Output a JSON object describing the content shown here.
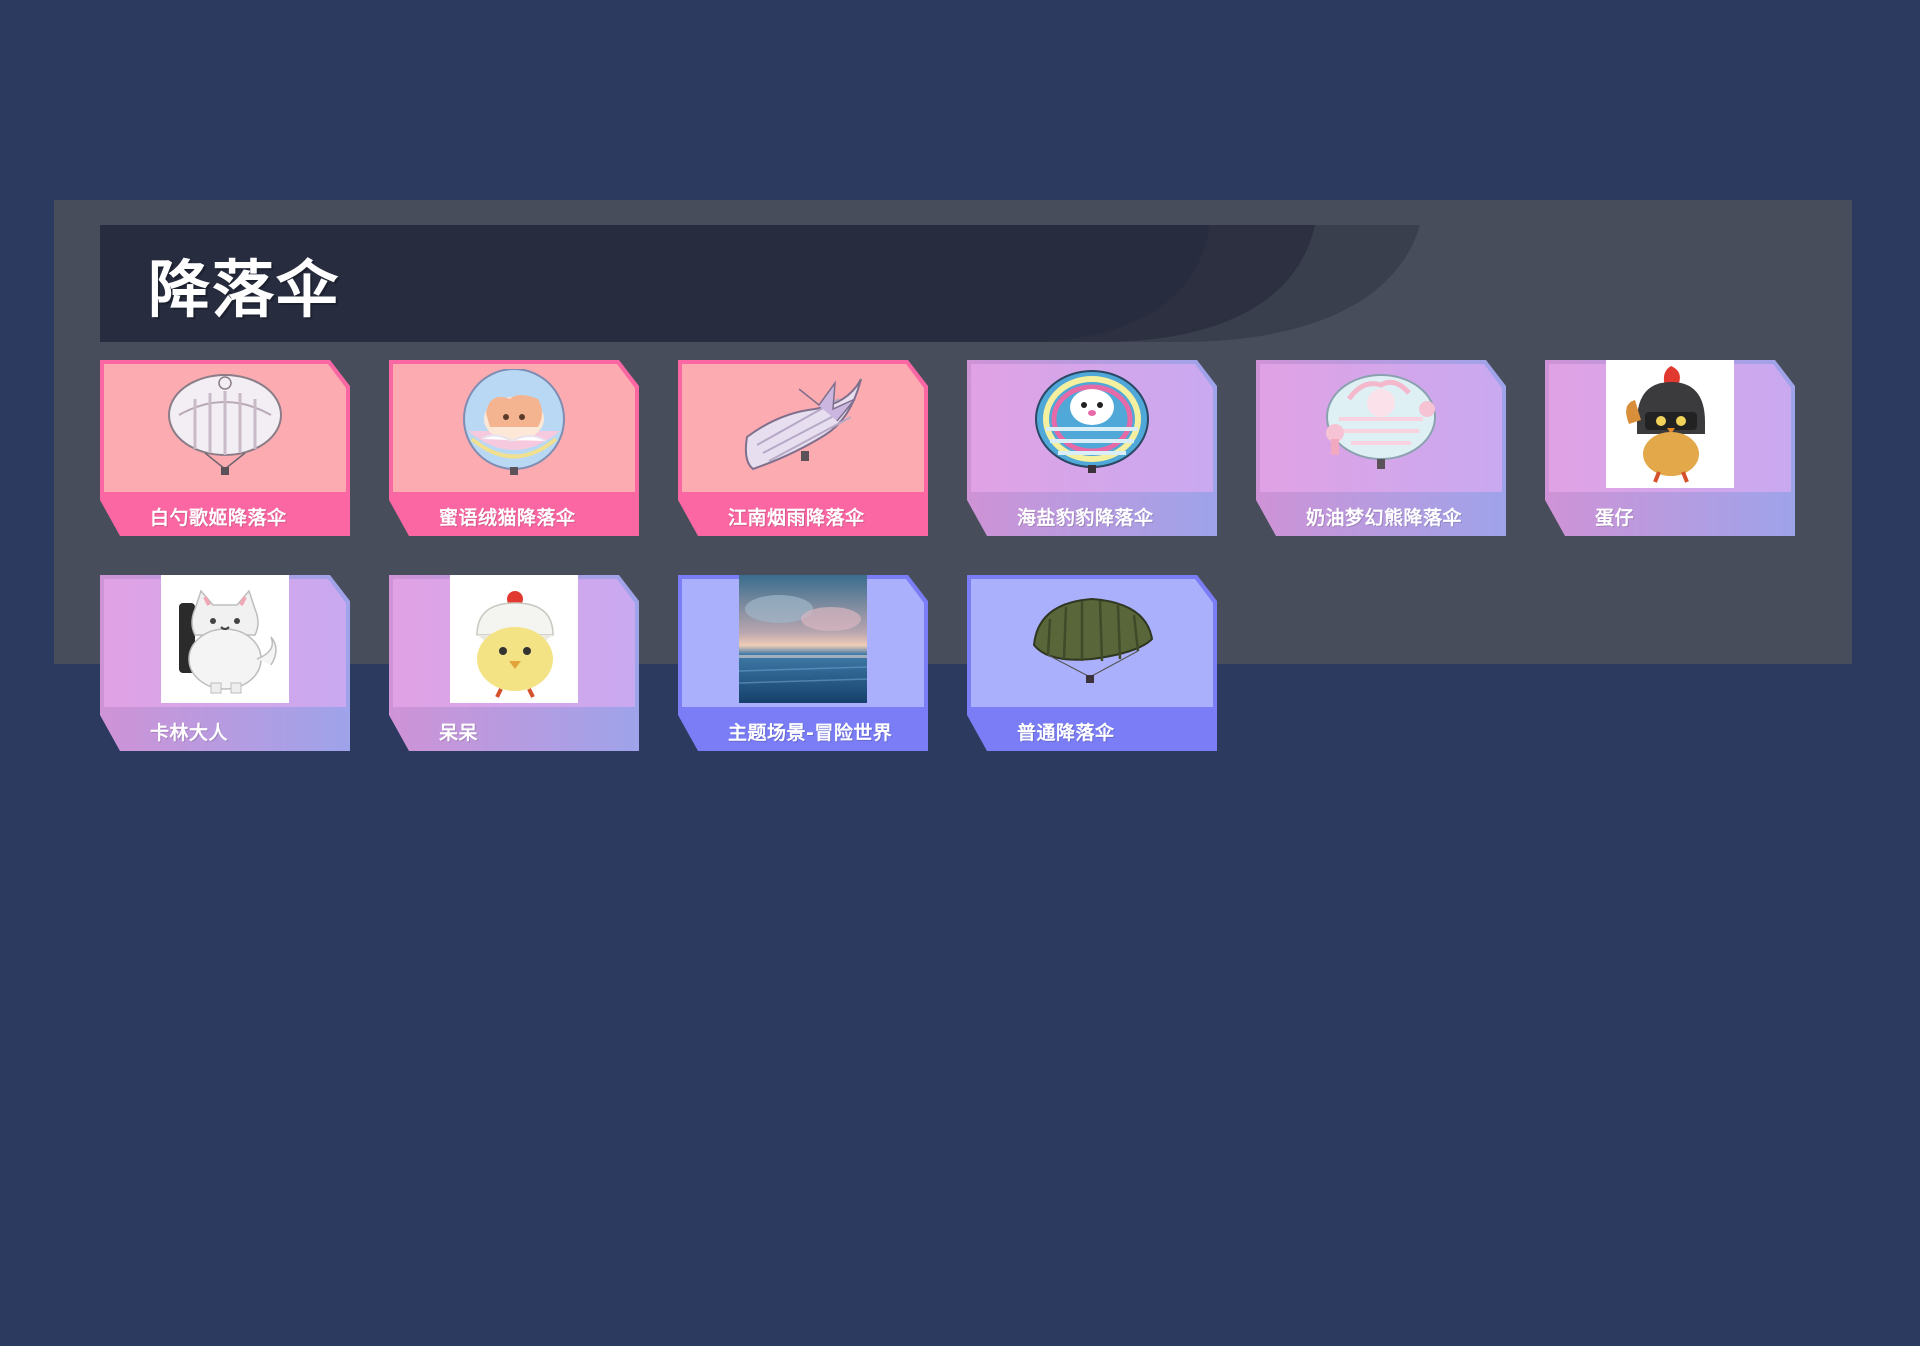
{
  "section": {
    "title": "降落伞"
  },
  "colors": {
    "page_bg": "#2d3a5f",
    "panel_bg": "#474d5a",
    "header_bg": "#272d40",
    "pink_card": "#fcabb1",
    "pink_strip": "#fb67a3",
    "purple_card": "#d9a6ee",
    "purple_strip": "#b3a3ea",
    "blue_card": "#aab0fb",
    "blue_strip": "#7a7df5"
  },
  "items": [
    {
      "name": "白勺歌姬降落伞",
      "tier": "pink",
      "icon": "white-parachute-icon"
    },
    {
      "name": "蜜语绒猫降落伞",
      "tier": "pink",
      "icon": "cat-parachute-icon"
    },
    {
      "name": "江南烟雨降落伞",
      "tier": "pink",
      "icon": "glider-parachute-icon"
    },
    {
      "name": "海盐豹豹降落伞",
      "tier": "purple",
      "icon": "seal-parachute-icon"
    },
    {
      "name": "奶油梦幻熊降落伞",
      "tier": "purple",
      "icon": "bear-parachute-icon"
    },
    {
      "name": "蛋仔",
      "tier": "purple",
      "icon": "eggy-helmet-icon"
    },
    {
      "name": "卡林大人",
      "tier": "purple",
      "icon": "white-cat-icon"
    },
    {
      "name": "呆呆",
      "tier": "purple",
      "icon": "yellow-chick-icon"
    },
    {
      "name": "主题场景-冒险世界",
      "tier": "blue",
      "icon": "sea-scene-icon"
    },
    {
      "name": "普通降落伞",
      "tier": "blue",
      "icon": "green-parachute-icon"
    }
  ]
}
